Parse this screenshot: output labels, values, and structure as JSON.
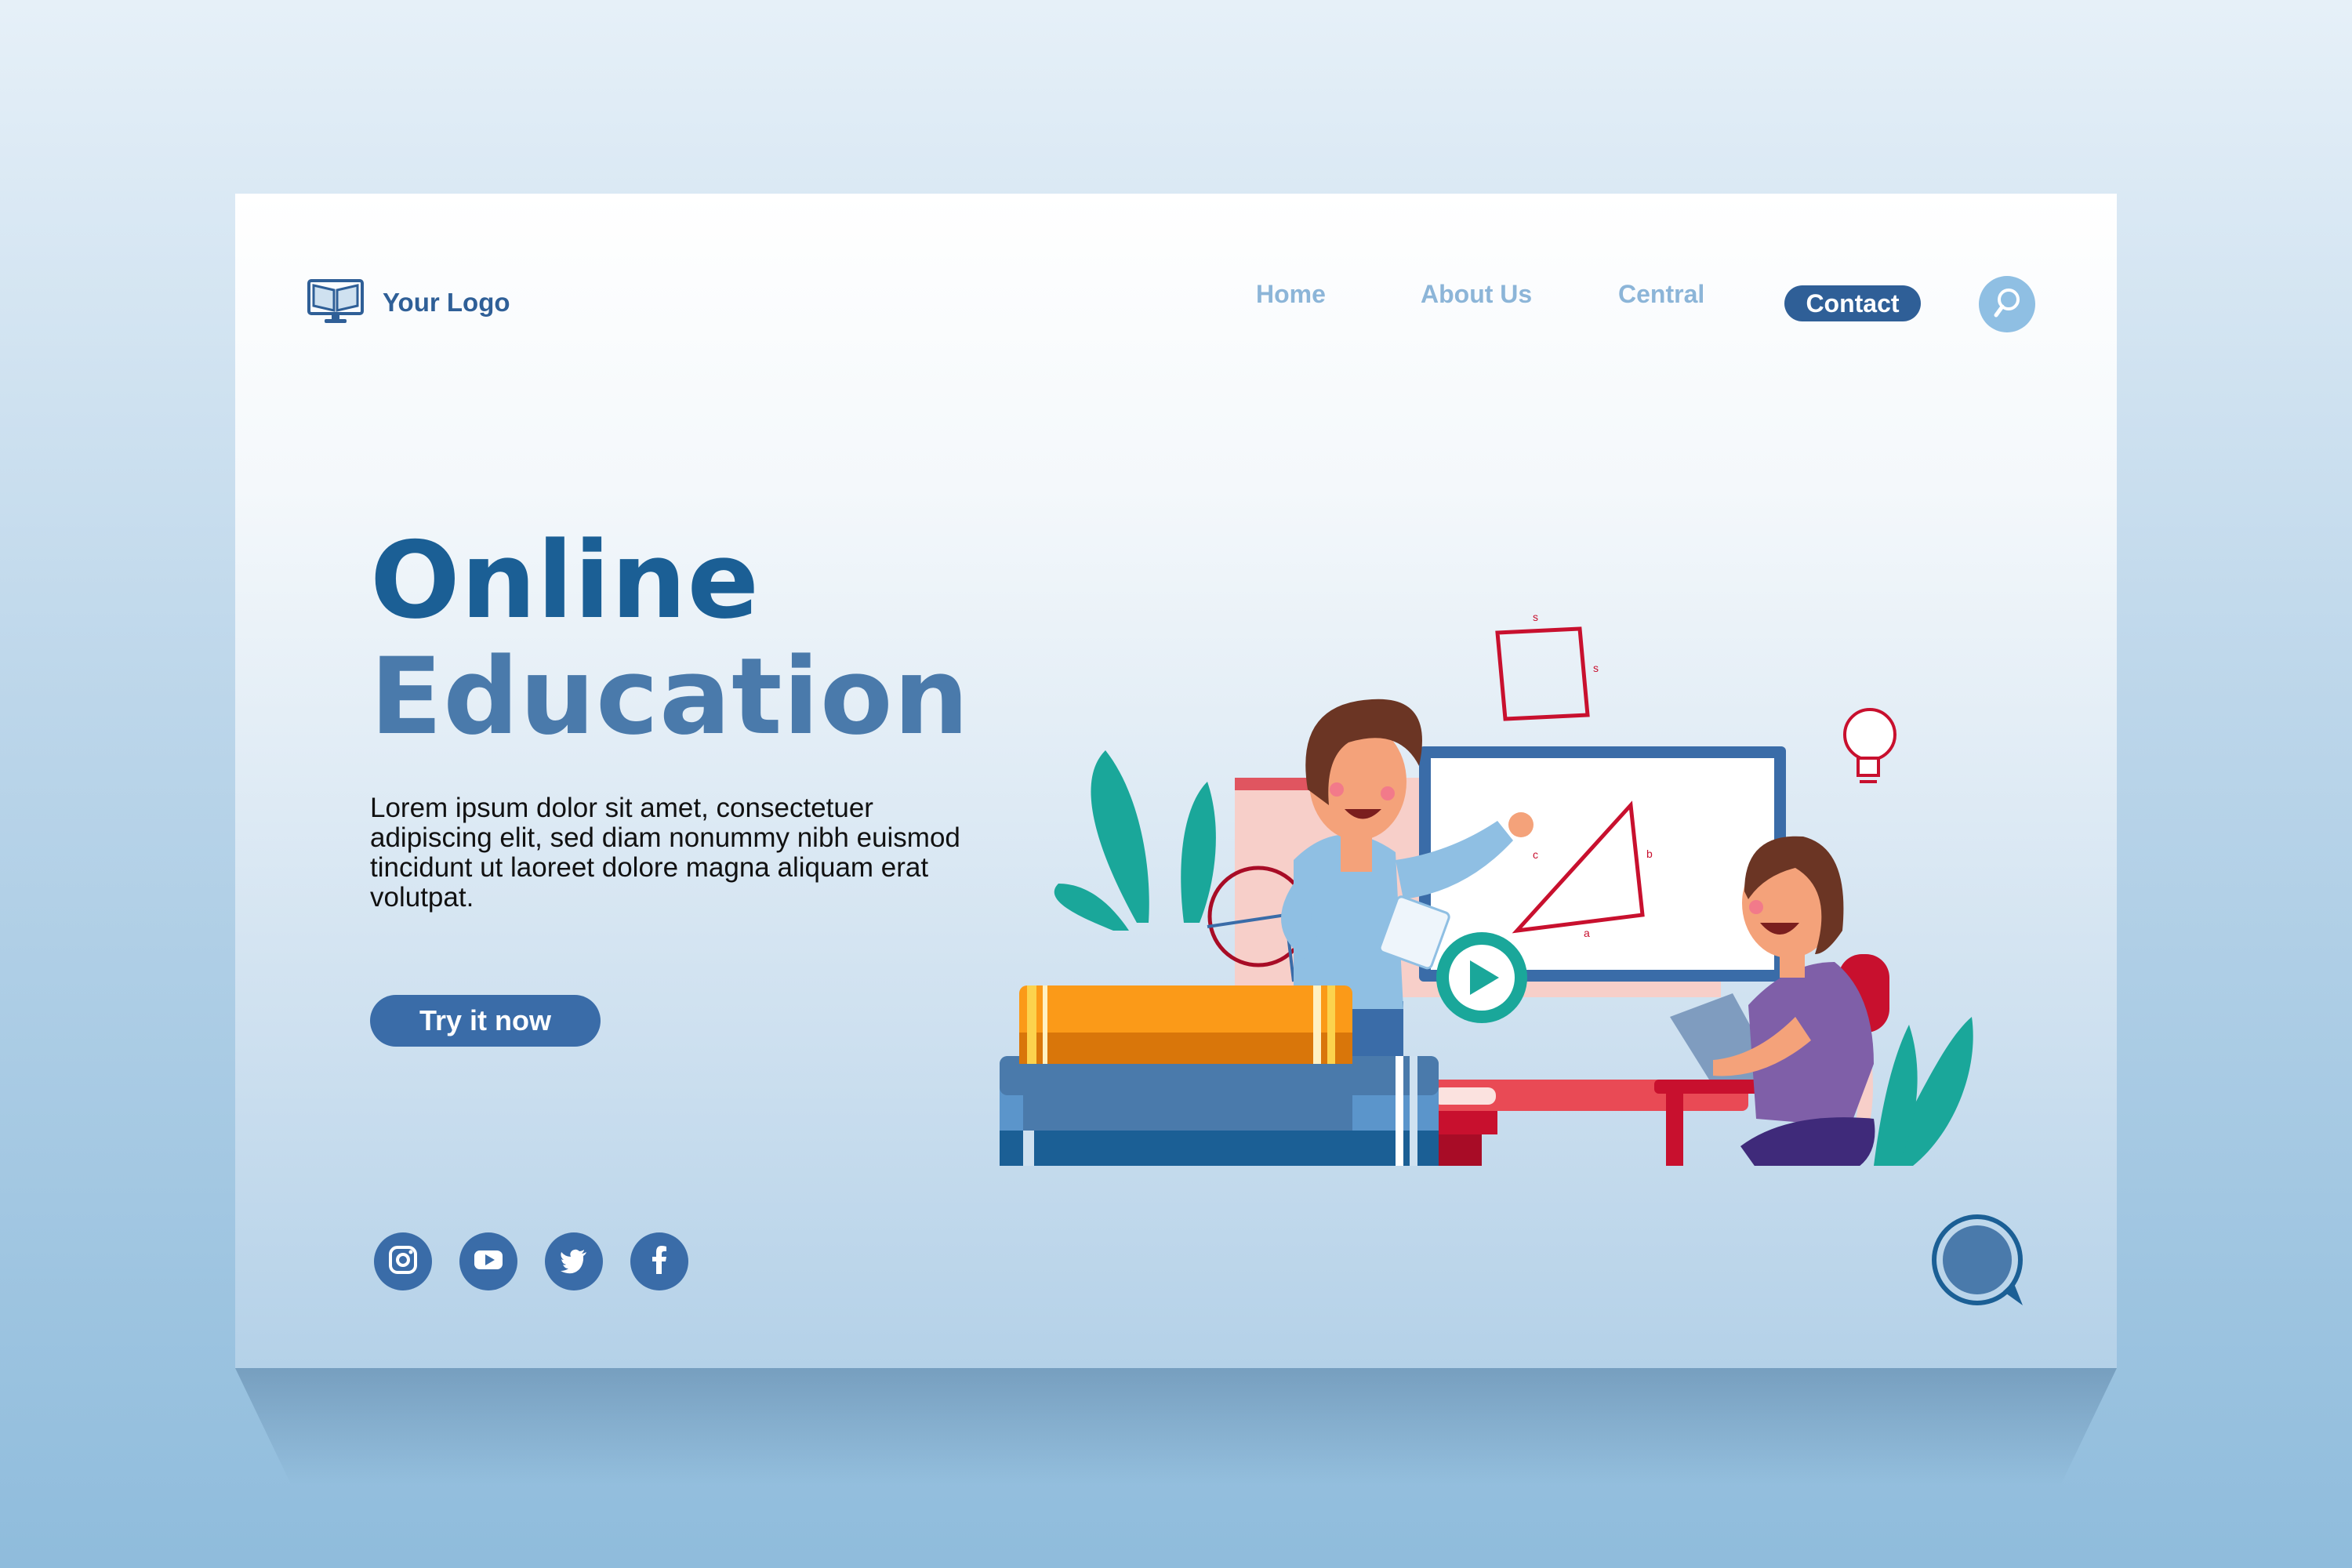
{
  "logo": {
    "text": "Your Logo",
    "icon": "book-monitor-icon"
  },
  "nav": {
    "items": [
      {
        "label": "Home"
      },
      {
        "label": "About Us"
      },
      {
        "label": "Central"
      }
    ],
    "contact_label": "Contact",
    "search_icon": "search-icon"
  },
  "hero": {
    "title_line1": "Online",
    "title_line2": "Education",
    "body": "Lorem ipsum dolor sit amet, consectetuer adipiscing elit, sed diam nonummy nibh euismod tincidunt ut laoreet dolore magna aliquam erat volutpat.",
    "cta_label": "Try it now"
  },
  "illustration": {
    "square_label_top": "s",
    "square_label_right": "s",
    "triangle_label_a": "a",
    "triangle_label_b": "b",
    "triangle_label_c": "c"
  },
  "social": [
    "instagram-icon",
    "youtube-icon",
    "twitter-icon",
    "facebook-icon"
  ],
  "chat_icon": "chat-bubble-icon",
  "colors": {
    "primary": "#2f5f97",
    "title_dark": "#1b5f95",
    "title_light": "#4a7aab",
    "nav_inactive": "#8cb5d8",
    "accent_red": "#c8102e",
    "accent_teal": "#1aa79a",
    "accent_orange": "#f7931e"
  }
}
